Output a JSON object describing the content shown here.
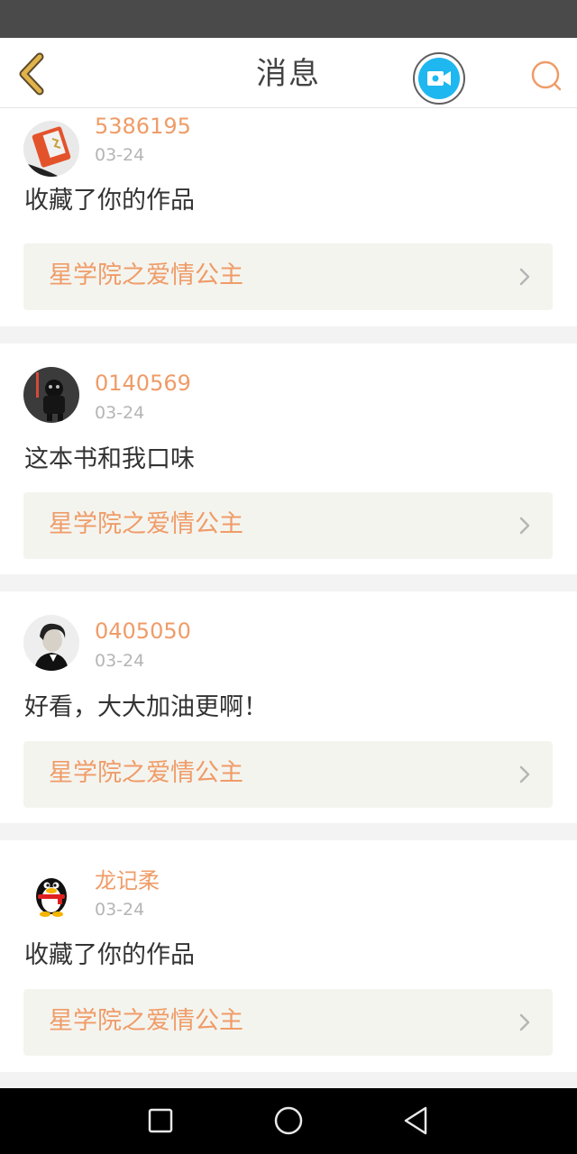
{
  "header": {
    "title": "消息",
    "back_icon": "chevron-left-icon",
    "video_icon": "video-camera-icon",
    "search_icon": "search-icon"
  },
  "colors": {
    "accent": "#ef9c68",
    "video_blue": "#1fb7ef",
    "back_icon": "#e2b24c"
  },
  "messages": [
    {
      "username": "5386195",
      "date": "03-24",
      "text": "收藏了你的作品",
      "work_title": "星学院之爱情公主",
      "avatar": "red-book-avatar"
    },
    {
      "username": "0140569",
      "date": "03-24",
      "text": "这本书和我口味",
      "work_title": "星学院之爱情公主",
      "avatar": "robot-avatar"
    },
    {
      "username": "0405050",
      "date": "03-24",
      "text": "好看，大大加油更啊！",
      "work_title": "星学院之爱情公主",
      "avatar": "person-avatar"
    },
    {
      "username": "龙记柔",
      "date": "03-24",
      "text": "收藏了你的作品",
      "work_title": "星学院之爱情公主",
      "avatar": "penguin-avatar"
    }
  ],
  "navbar": {
    "icons": [
      "recent-apps-icon",
      "home-icon",
      "back-triangle-icon"
    ]
  }
}
